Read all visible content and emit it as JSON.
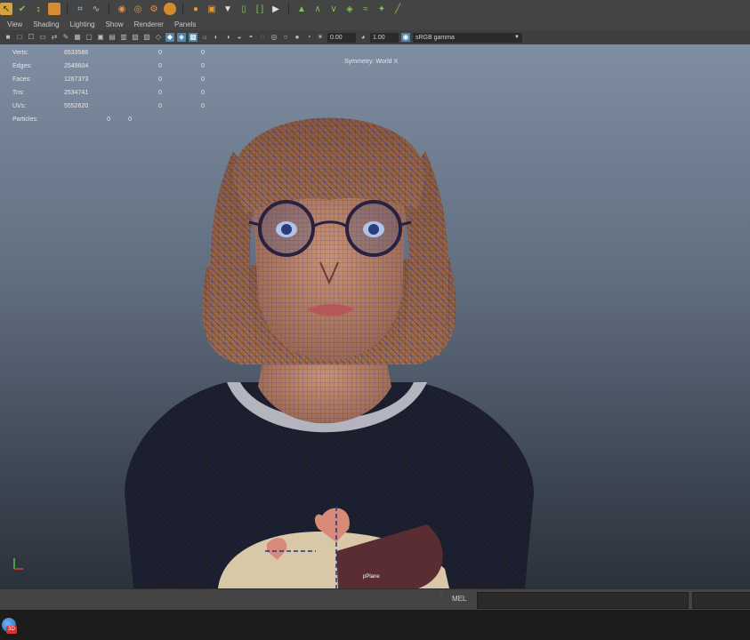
{
  "panel_menu": {
    "items": [
      "View",
      "Shading",
      "Lighting",
      "Show",
      "Renderer",
      "Panels"
    ]
  },
  "panel_toolbar": {
    "near_value": "0.00",
    "far_value": "1.00",
    "color_space": "sRGB gamma"
  },
  "hud": {
    "rows": [
      {
        "label": "Verts:",
        "value": "6533586",
        "sel": "0",
        "cmp": "0"
      },
      {
        "label": "Edges:",
        "value": "2549604",
        "sel": "0",
        "cmp": "0"
      },
      {
        "label": "Faces:",
        "value": "1267373",
        "sel": "0",
        "cmp": "0"
      },
      {
        "label": "Tris:",
        "value": "2534741",
        "sel": "0",
        "cmp": "0"
      },
      {
        "label": "UVs:",
        "value": "5552620",
        "sel": "0",
        "cmp": "0"
      },
      {
        "label": "Particles:",
        "value": "",
        "sel": "0",
        "cmp": "0"
      }
    ],
    "symmetry": "Symmetry: World X"
  },
  "viewport": {
    "mesh_label": "pPlane"
  },
  "command_line": {
    "label": "MEL"
  },
  "taskbar": {
    "badge": "3D"
  },
  "colors": {
    "selection_highlight": "#5285a6",
    "viewport_top": "#7f8ea2",
    "viewport_bottom": "#2c323b",
    "wireframe": "#1c2a8c"
  }
}
